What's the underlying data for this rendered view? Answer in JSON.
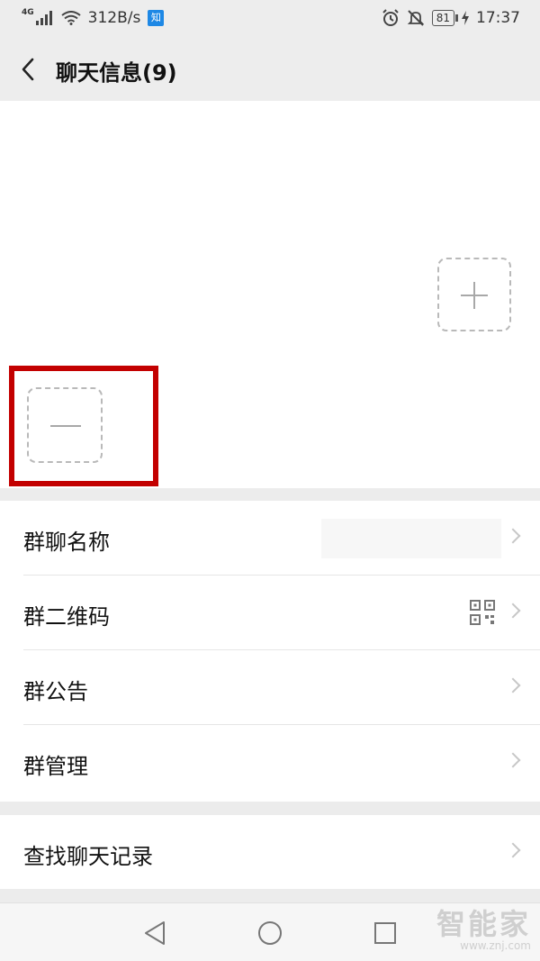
{
  "status_bar": {
    "network": "4G",
    "speed": "312B/s",
    "app_badge": "知",
    "battery": "81",
    "time": "17:37"
  },
  "header": {
    "title": "聊天信息(9)"
  },
  "settings": {
    "items": [
      {
        "label": "群聊名称"
      },
      {
        "label": "群二维码"
      },
      {
        "label": "群公告"
      },
      {
        "label": "群管理"
      }
    ],
    "search_label": "查找聊天记录"
  },
  "watermark": {
    "brand": "智能家",
    "url": "www.znj.com"
  },
  "colors": {
    "highlight": "#c30000",
    "app_badge": "#1e88e5"
  }
}
